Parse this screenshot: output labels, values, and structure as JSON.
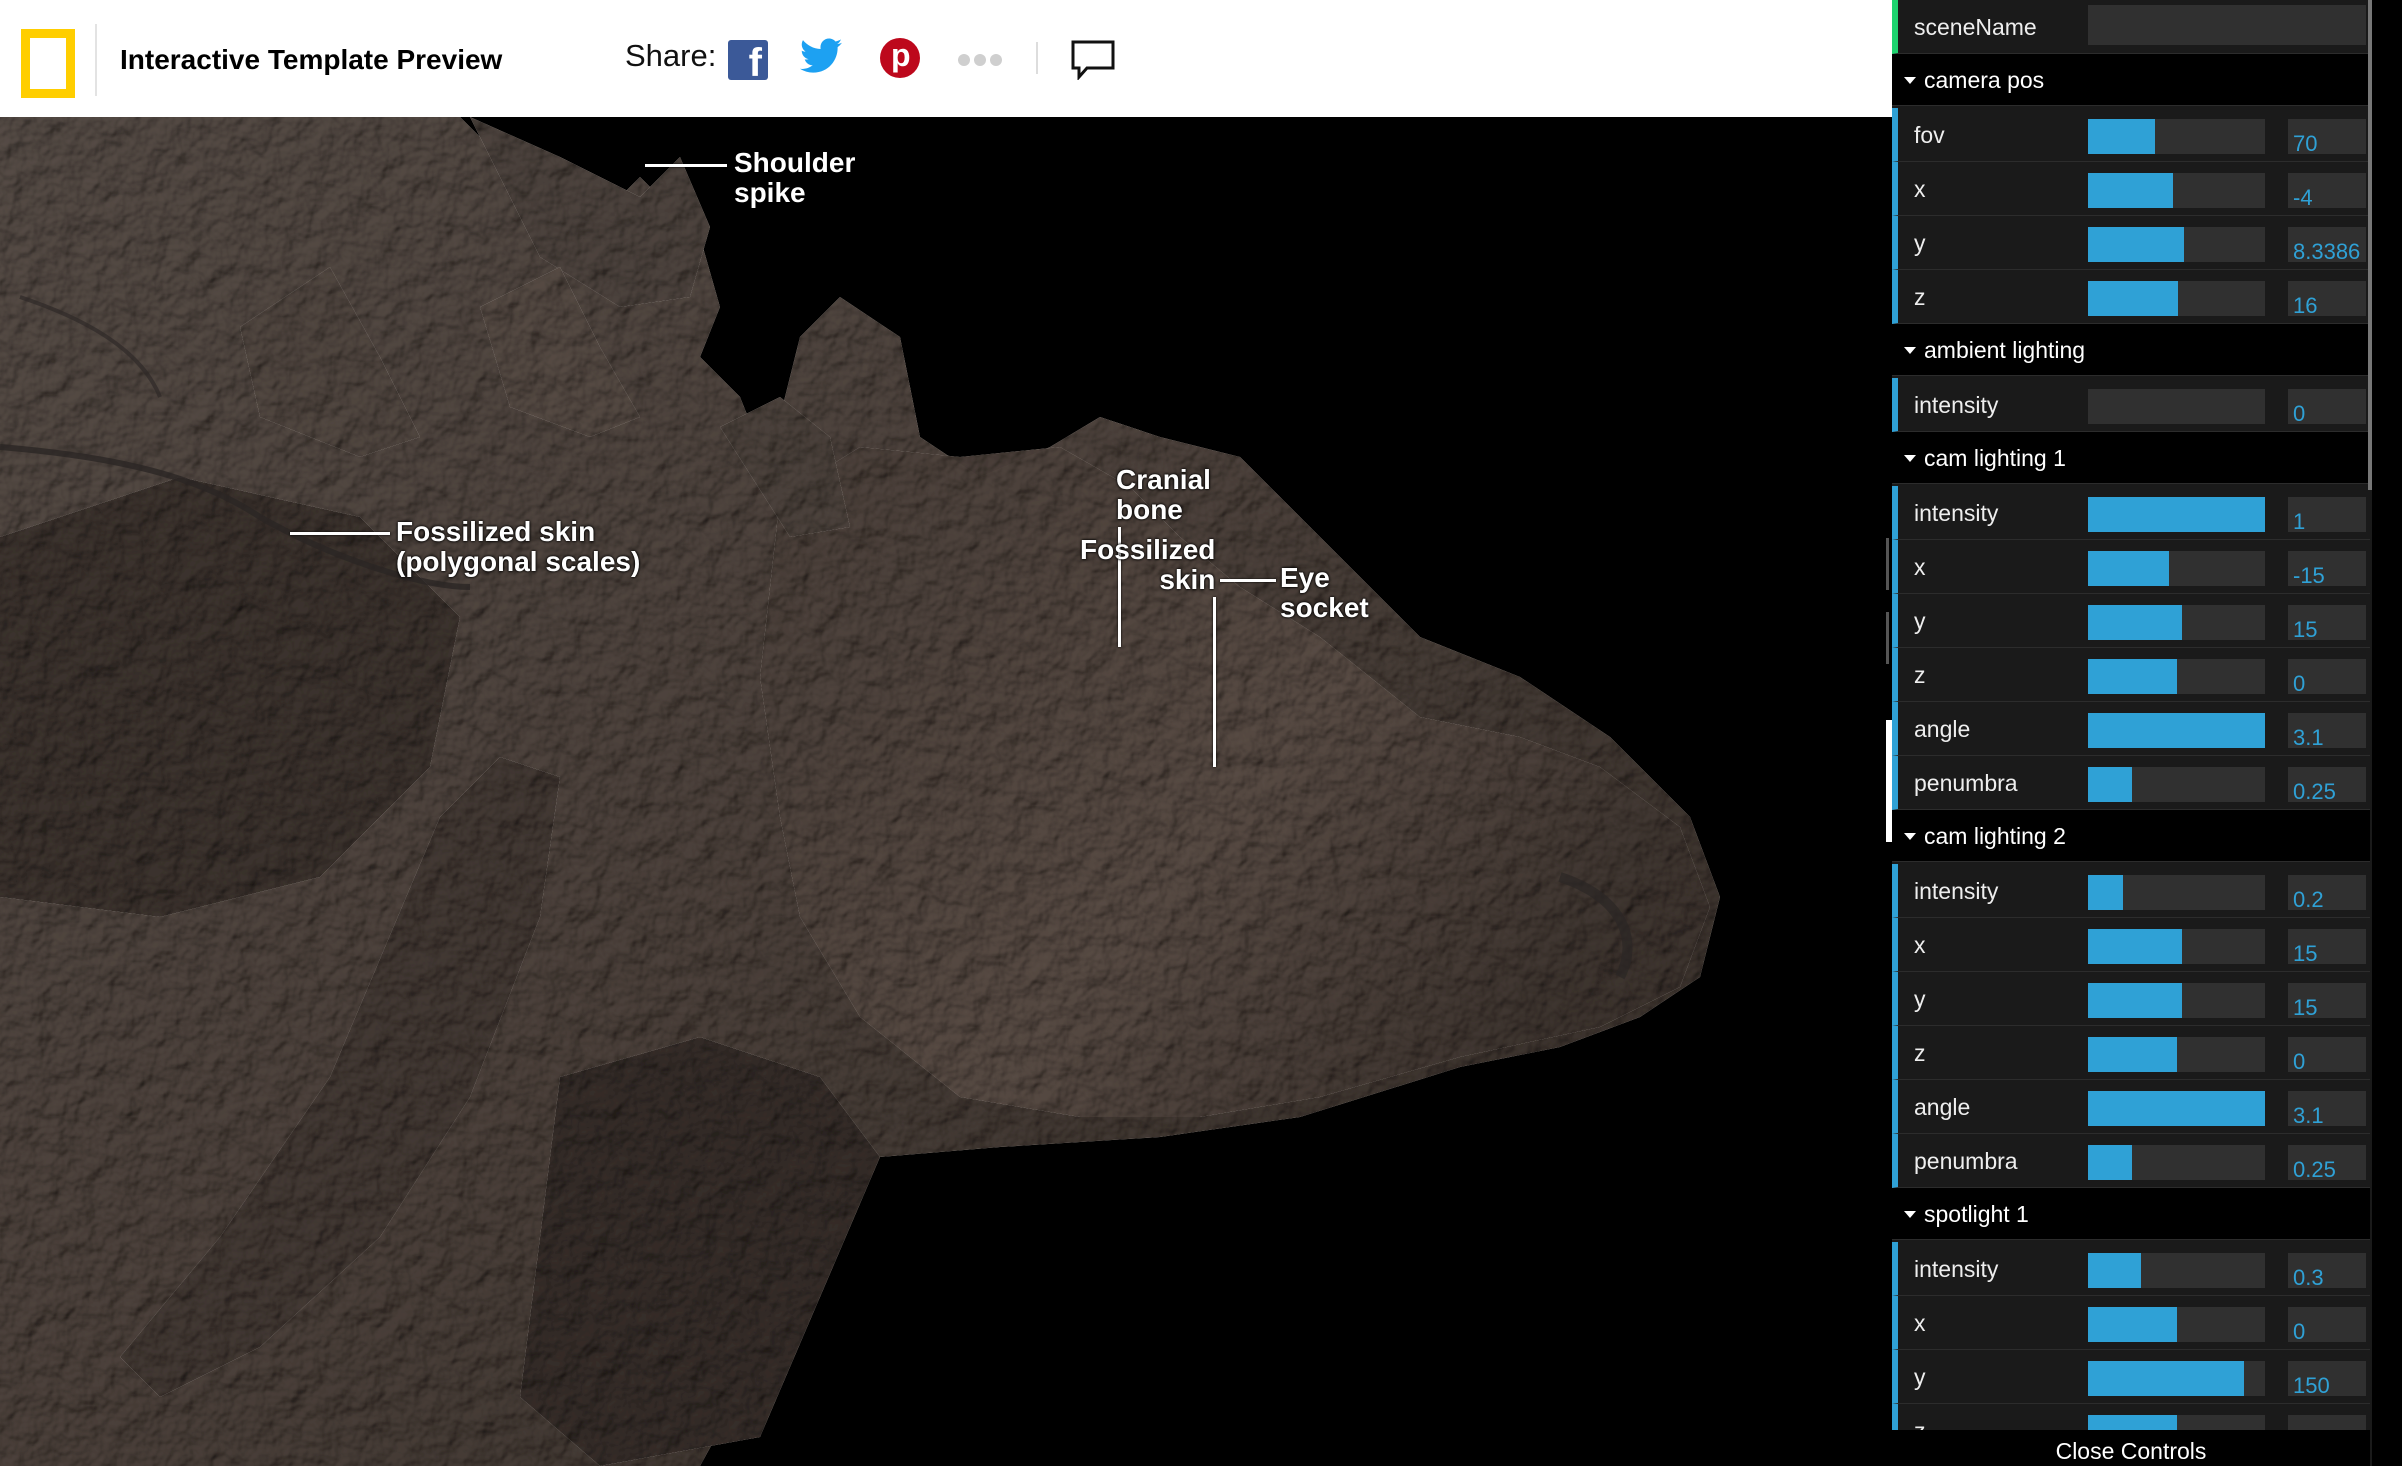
{
  "header": {
    "title": "Interactive Template Preview",
    "share_label": "Share:",
    "icons": [
      "national-geographic-logo",
      "facebook-icon",
      "twitter-icon",
      "pinterest-icon",
      "more-icon",
      "comment-icon"
    ],
    "colors": {
      "logo": "#FFCE00",
      "facebook": "#3B5998",
      "twitter": "#1DA1F2",
      "pinterest": "#BD081C"
    }
  },
  "annotations": {
    "shoulder_spike": "Shoulder\nspike",
    "fossilized_skin_scales": "Fossilized skin\n(polygonal scales)",
    "cranial_bone": "Cranial\nbone",
    "fossilized_skin": "Fossilized\nskin",
    "eye_socket": "Eye\nsocket"
  },
  "gui": {
    "accent_color": "#2FA1D6",
    "scene_name_label": "sceneName",
    "scene_name_value": "",
    "folders": [
      {
        "name": "camera pos",
        "controls": [
          {
            "label": "fov",
            "value": "70",
            "fill": 0.38
          },
          {
            "label": "x",
            "value": "-4",
            "fill": 0.48
          },
          {
            "label": "y",
            "value": "8.3386",
            "fill": 0.54
          },
          {
            "label": "z",
            "value": "16",
            "fill": 0.51
          }
        ]
      },
      {
        "name": "ambient lighting",
        "controls": [
          {
            "label": "intensity",
            "value": "0",
            "fill": 0
          }
        ]
      },
      {
        "name": "cam lighting 1",
        "controls": [
          {
            "label": "intensity",
            "value": "1",
            "fill": 1
          },
          {
            "label": "x",
            "value": "-15",
            "fill": 0.46
          },
          {
            "label": "y",
            "value": "15",
            "fill": 0.53
          },
          {
            "label": "z",
            "value": "0",
            "fill": 0.5
          },
          {
            "label": "angle",
            "value": "3.1",
            "fill": 1
          },
          {
            "label": "penumbra",
            "value": "0.25",
            "fill": 0.25
          }
        ]
      },
      {
        "name": "cam lighting 2",
        "controls": [
          {
            "label": "intensity",
            "value": "0.2",
            "fill": 0.2
          },
          {
            "label": "x",
            "value": "15",
            "fill": 0.53
          },
          {
            "label": "y",
            "value": "15",
            "fill": 0.53
          },
          {
            "label": "z",
            "value": "0",
            "fill": 0.5
          },
          {
            "label": "angle",
            "value": "3.1",
            "fill": 1
          },
          {
            "label": "penumbra",
            "value": "0.25",
            "fill": 0.25
          }
        ]
      },
      {
        "name": "spotlight 1",
        "controls": [
          {
            "label": "intensity",
            "value": "0.3",
            "fill": 0.3
          },
          {
            "label": "x",
            "value": "0",
            "fill": 0.5
          },
          {
            "label": "y",
            "value": "150",
            "fill": 0.88
          },
          {
            "label": "z",
            "value": "",
            "fill": 0.5
          }
        ]
      }
    ],
    "close_label": "Close Controls"
  }
}
